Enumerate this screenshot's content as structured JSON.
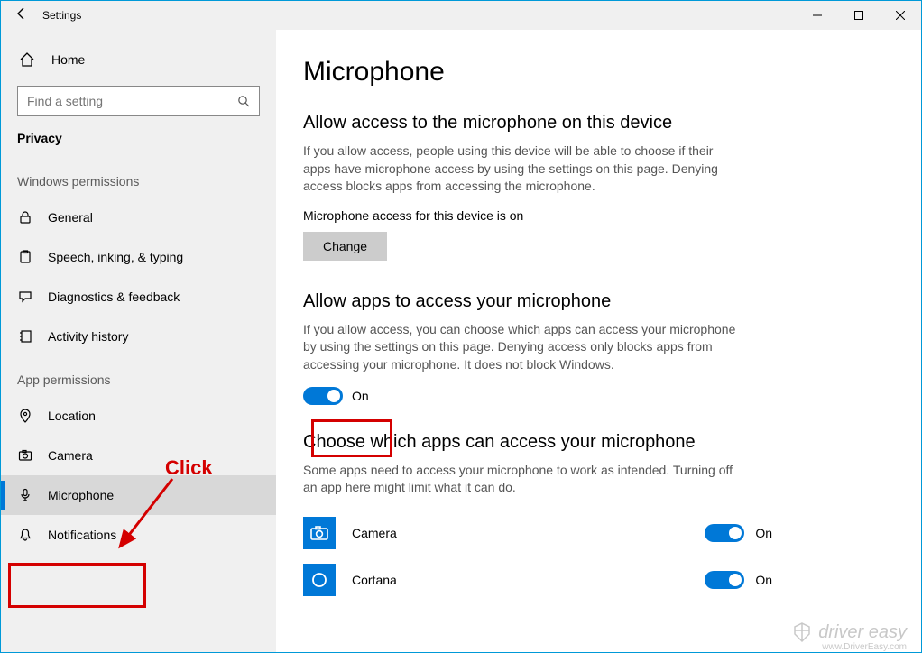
{
  "titlebar": {
    "title": "Settings"
  },
  "sidebar": {
    "home_label": "Home",
    "search_placeholder": "Find a setting",
    "section_label": "Privacy",
    "group_windows": "Windows permissions",
    "group_app": "App permissions",
    "items_windows": [
      {
        "label": "General"
      },
      {
        "label": "Speech, inking, & typing"
      },
      {
        "label": "Diagnostics & feedback"
      },
      {
        "label": "Activity history"
      }
    ],
    "items_app": [
      {
        "label": "Location"
      },
      {
        "label": "Camera"
      },
      {
        "label": "Microphone"
      },
      {
        "label": "Notifications"
      }
    ]
  },
  "main": {
    "page_title": "Microphone",
    "section1_heading": "Allow access to the microphone on this device",
    "section1_desc": "If you allow access, people using this device will be able to choose if their apps have microphone access by using the settings on this page. Denying access blocks apps from accessing the microphone.",
    "access_status": "Microphone access for this device is on",
    "change_label": "Change",
    "section2_heading": "Allow apps to access your microphone",
    "section2_desc": "If you allow access, you can choose which apps can access your microphone by using the settings on this page. Denying access only blocks apps from accessing your microphone. It does not block Windows.",
    "toggle_label": "On",
    "section3_heading": "Choose which apps can access your microphone",
    "section3_desc": "Some apps need to access your microphone to work as intended. Turning off an app here might limit what it can do.",
    "apps": [
      {
        "name": "Camera",
        "toggle": "On"
      },
      {
        "name": "Cortana",
        "toggle": "On"
      }
    ]
  },
  "annot": {
    "click": "Click"
  },
  "watermark": {
    "text": "driver easy",
    "url": "www.DriverEasy.com"
  }
}
